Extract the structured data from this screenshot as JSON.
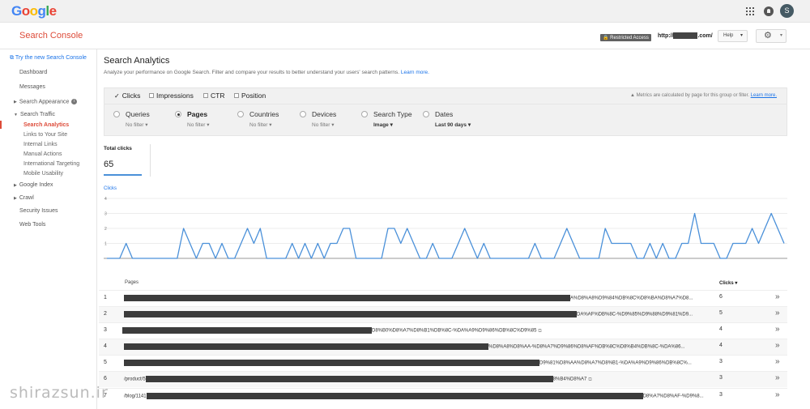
{
  "google_bar": {
    "logo": [
      "G",
      "o",
      "o",
      "g",
      "l",
      "e"
    ],
    "avatar_letter": "S"
  },
  "console_header": {
    "title": "Search Console",
    "restricted_badge": "Restricted Access",
    "site_prefix": "http://",
    "site_suffix": ".com/",
    "help_label": "Help"
  },
  "sidebar": {
    "try_new": "Try the new Search Console",
    "dashboard": "Dashboard",
    "messages": "Messages",
    "search_appearance": "Search Appearance",
    "search_traffic": "Search Traffic",
    "search_analytics": "Search Analytics",
    "links_to_site": "Links to Your Site",
    "internal_links": "Internal Links",
    "manual_actions": "Manual Actions",
    "international_targeting": "International Targeting",
    "mobile_usability": "Mobile Usability",
    "google_index": "Google Index",
    "crawl": "Crawl",
    "security_issues": "Security Issues",
    "web_tools": "Web Tools"
  },
  "main": {
    "title": "Search Analytics",
    "description": "Analyze your performance on Google Search. Filter and compare your results to better understand your users' search patterns.",
    "learn_more": "Learn more."
  },
  "metrics": {
    "clicks": "Clicks",
    "impressions": "Impressions",
    "ctr": "CTR",
    "position": "Position",
    "note": "Metrics are calculated by page for this group or filter.",
    "note_link": "Learn more."
  },
  "filters": {
    "queries": {
      "label": "Queries",
      "value": "No filter"
    },
    "pages": {
      "label": "Pages",
      "value": "No filter"
    },
    "countries": {
      "label": "Countries",
      "value": "No filter"
    },
    "devices": {
      "label": "Devices",
      "value": "No filter"
    },
    "search_type": {
      "label": "Search Type",
      "value": "Image"
    },
    "dates": {
      "label": "Dates",
      "value": "Last 90 days"
    }
  },
  "total": {
    "label": "Total clicks",
    "value": "65"
  },
  "chart_data": {
    "type": "line",
    "ylabel": "Clicks",
    "ylim": [
      0,
      4
    ],
    "y_ticks": [
      "1",
      "2",
      "3",
      "4"
    ],
    "grid": true,
    "color": "#4a90d9",
    "values": [
      0,
      0,
      0,
      1,
      0,
      0,
      0,
      0,
      0,
      0,
      0,
      0,
      2,
      1,
      0,
      1,
      1,
      0,
      1,
      0,
      0,
      1,
      2,
      1,
      2,
      0,
      0,
      0,
      0,
      1,
      0,
      1,
      0,
      1,
      0,
      1,
      1,
      2,
      2,
      0,
      0,
      0,
      0,
      0,
      2,
      2,
      1,
      2,
      1,
      0,
      0,
      1,
      0,
      0,
      0,
      1,
      2,
      1,
      0,
      1,
      0,
      0,
      0,
      0,
      0,
      0,
      0,
      1,
      0,
      0,
      0,
      1,
      2,
      1,
      0,
      0,
      0,
      0,
      2,
      1,
      1,
      1,
      1,
      0,
      0,
      1,
      0,
      1,
      0,
      0,
      1,
      1,
      3,
      1,
      1,
      1,
      0,
      0,
      1,
      1,
      1,
      2,
      1,
      2,
      3,
      2,
      1
    ]
  },
  "table": {
    "col_pages": "Pages",
    "col_clicks": "Clicks ▾",
    "rows": [
      {
        "num": "1",
        "prefix": "",
        "suffix": "A%D8%A8%D9%84%DB%8C%D8%BA%D8%A7%D8...",
        "clicks": "6",
        "ext": false
      },
      {
        "num": "2",
        "prefix": "",
        "suffix": "DA%AF%DB%8C-%D9%85%D9%88%D9%81%D9...",
        "clicks": "5",
        "ext": false
      },
      {
        "num": "3",
        "prefix": "",
        "suffix": "D8%B0%D8%A7%D8%B1%DB%8C-%DA%A9%D9%86%DB%8C%D9%85",
        "clicks": "4",
        "ext": true
      },
      {
        "num": "4",
        "prefix": "",
        "suffix": "%D8%A8%D8%AA-%D8%A7%D9%86%D8%AF%DB%8C%D8%B4%DB%8C-%DA%86...",
        "clicks": "4",
        "ext": false
      },
      {
        "num": "5",
        "prefix": "",
        "suffix": "D9%81%D8%AA%D8%A7%D8%B1-%DA%A9%D9%86%DB%8C%...",
        "clicks": "3",
        "ext": false
      },
      {
        "num": "6",
        "prefix": "/product/5",
        "suffix": "8%B4%D8%A7",
        "clicks": "3",
        "ext": true
      },
      {
        "num": "7",
        "prefix": "/blog/1141",
        "suffix": "D8%A7%D8%AF-%D9%8...",
        "clicks": "3",
        "ext": false
      }
    ]
  },
  "watermark": "shirazsun.ir"
}
